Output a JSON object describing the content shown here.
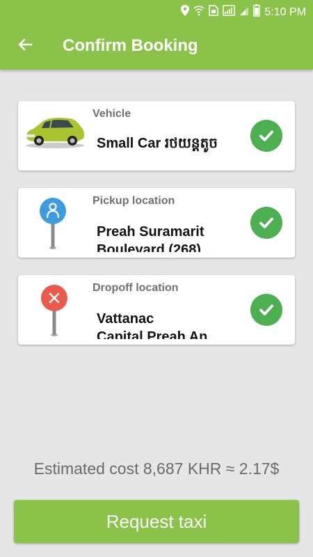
{
  "status_bar": {
    "time": "5:10 PM",
    "icons": [
      "location-icon",
      "wifi-icon",
      "sim-icon",
      "signal-icon",
      "signal-icon",
      "battery-icon"
    ]
  },
  "header": {
    "title": "Confirm Booking",
    "back_icon": "arrow-left-icon"
  },
  "cards": [
    {
      "label": "Vehicle",
      "value": "Small Car រថយន្តតូច",
      "icon": "car-image",
      "status_icon": "check-icon"
    },
    {
      "label": "Pickup location",
      "value": "Preah Suramarit Boulevard (268),...",
      "icon": "pickup-pin-icon",
      "status_icon": "check-icon"
    },
    {
      "label": "Dropoff location",
      "value": "Vattanac Capital,Preah An...",
      "icon": "dropoff-pin-icon",
      "status_icon": "check-icon"
    }
  ],
  "estimate": "Estimated cost 8,687 KHR ≈ 2.17$",
  "request_button_label": "Request taxi",
  "colors": {
    "primary": "#8bc34a",
    "check": "#4caf50",
    "pickup_pin": "#3f9be0",
    "dropoff_pin": "#ea5b4b",
    "background": "#e6e6e6"
  }
}
